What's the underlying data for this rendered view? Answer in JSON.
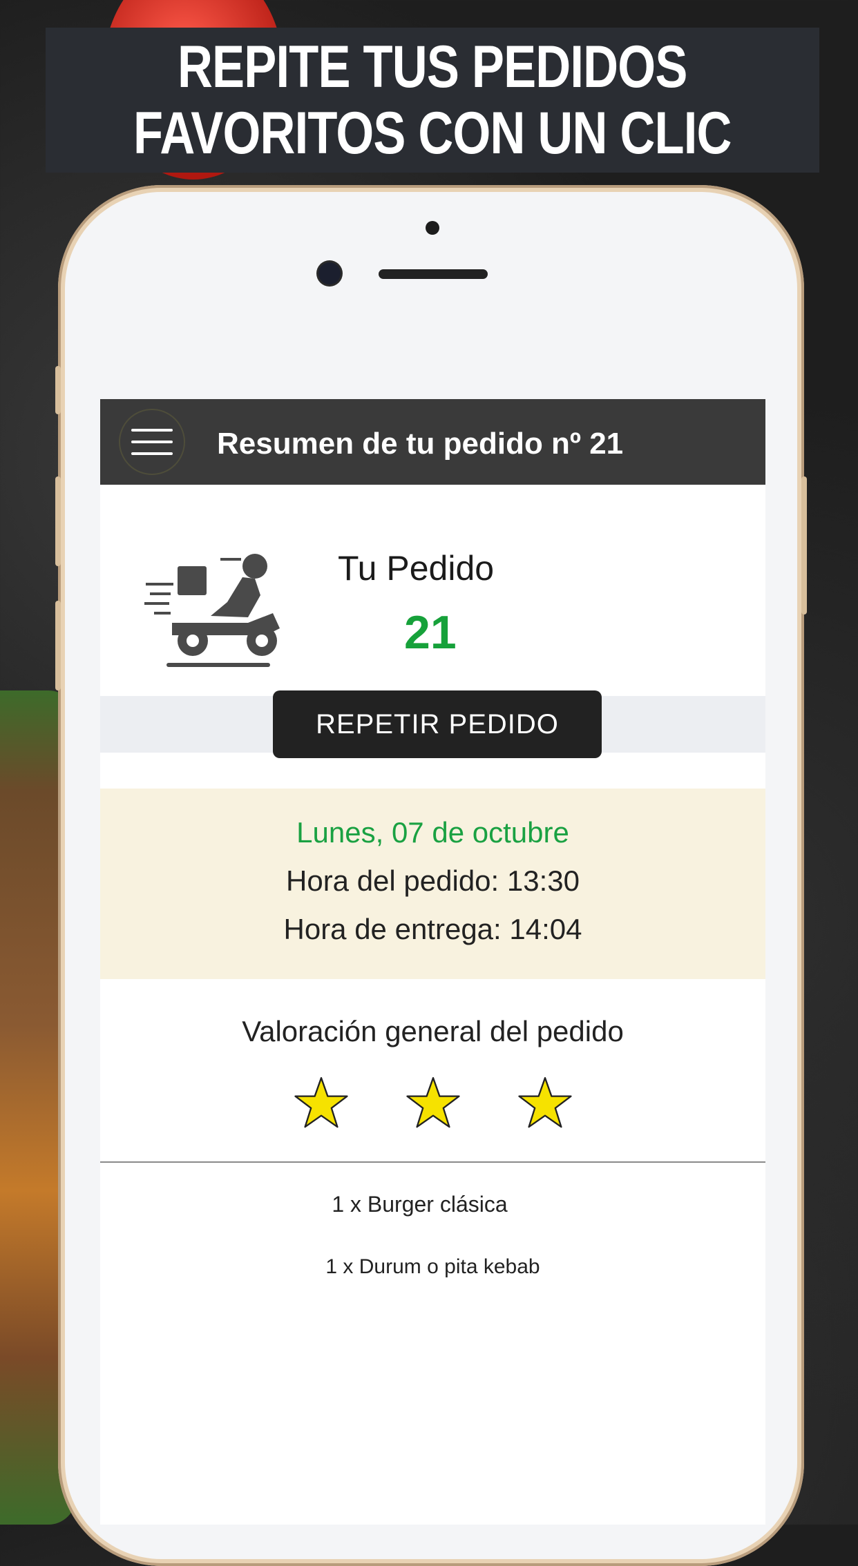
{
  "banner": {
    "line1": "REPITE TUS PEDIDOS",
    "line2": "FAVORITOS CON UN CLIC"
  },
  "app": {
    "header_title": "Resumen de tu pedido nº 21",
    "order_label": "Tu Pedido",
    "order_number": "21",
    "repeat_button": "REPETIR PEDIDO",
    "date": "Lunes, 07 de octubre",
    "order_time": "Hora del pedido: 13:30",
    "delivery_time": "Hora de entrega: 14:04",
    "rating_title": "Valoración general del pedido",
    "rating_stars": 3,
    "items": [
      "1 x  Burger clásica",
      "1 x  Durum o pita kebab"
    ]
  },
  "colors": {
    "header": "#3a3a3a",
    "accent_green": "#16a13a",
    "dates_bg": "#f8f2df",
    "star": "#f6e200"
  },
  "icons": {
    "menu": "hamburger-menu-icon",
    "delivery": "delivery-scooter-icon",
    "rating": "star-icon"
  }
}
